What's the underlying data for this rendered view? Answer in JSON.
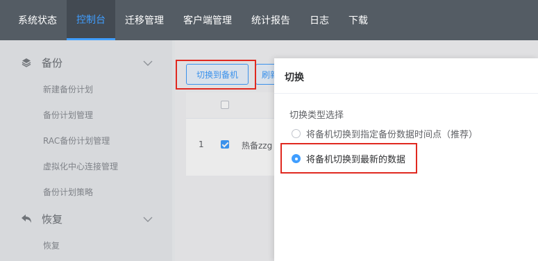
{
  "topnav": {
    "items": [
      {
        "label": "系统状态"
      },
      {
        "label": "控制台",
        "active": true
      },
      {
        "label": "迁移管理"
      },
      {
        "label": "客户端管理"
      },
      {
        "label": "统计报告"
      },
      {
        "label": "日志"
      },
      {
        "label": "下载"
      }
    ]
  },
  "sidebar": {
    "backup": {
      "label": "备份",
      "icon": "layers-icon",
      "items": [
        "新建备份计划",
        "备份计划管理",
        "RAC备份计划管理",
        "虚拟化中心连接管理",
        "备份计划策略"
      ]
    },
    "restore": {
      "label": "恢复",
      "icon": "undo-icon",
      "items": [
        "恢复"
      ]
    }
  },
  "toolbar": {
    "switch_label": "切换到备机",
    "refresh_label": "刷新"
  },
  "table": {
    "rows": [
      {
        "index": "1",
        "name": "热备zzg",
        "checked": true
      }
    ]
  },
  "dialog": {
    "title": "切换",
    "type_label": "切换类型选择",
    "options": [
      {
        "label": "将备机切换到指定备份数据时间点（推荐）",
        "selected": false
      },
      {
        "label": "将备机切换到最新的数据",
        "selected": true
      }
    ]
  },
  "colors": {
    "nav_bg": "#545c64",
    "accent": "#409eff",
    "highlight": "#e0281f"
  }
}
